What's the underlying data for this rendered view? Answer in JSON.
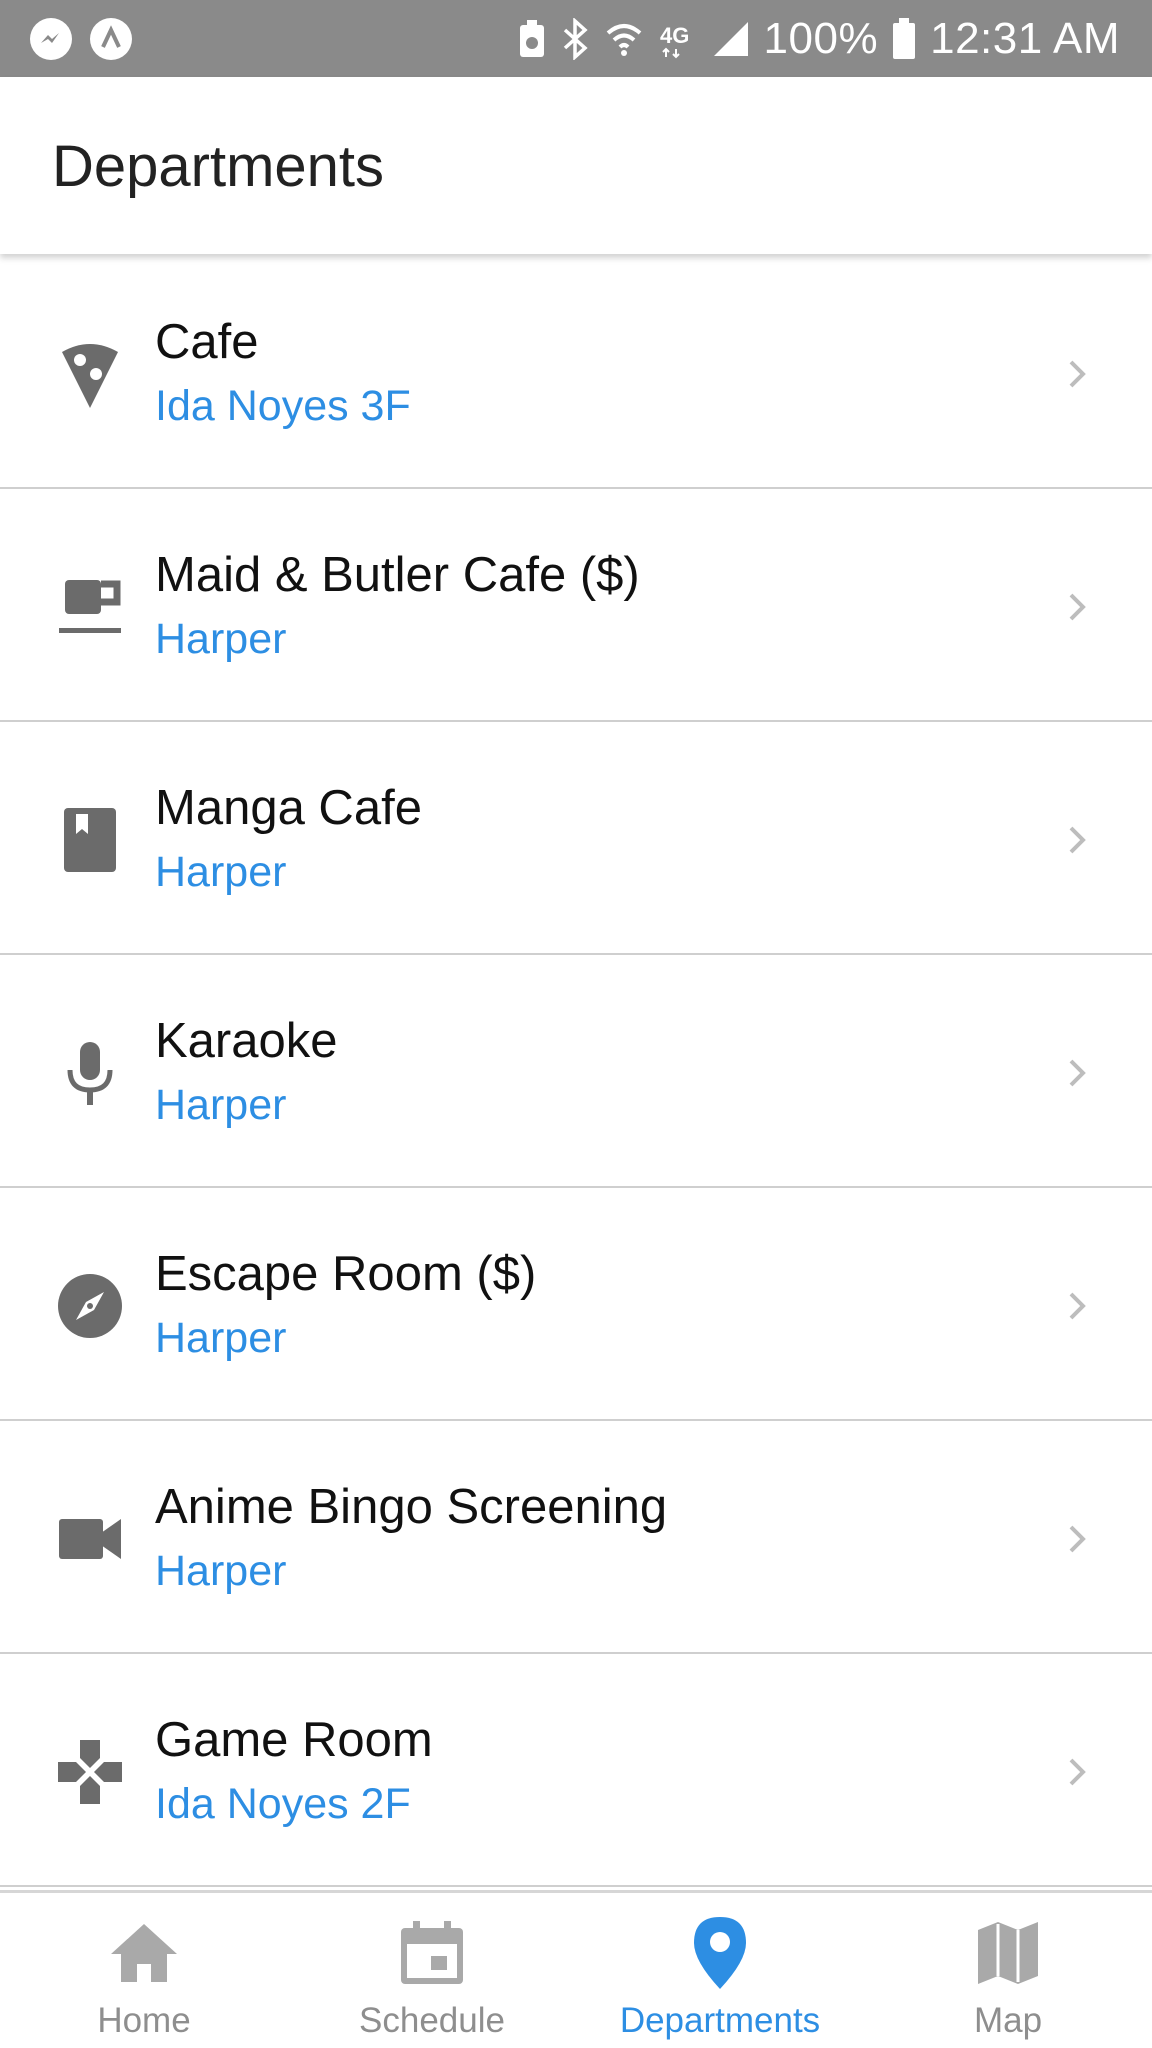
{
  "status_bar": {
    "battery": "100%",
    "time": "12:31 AM"
  },
  "header": {
    "title": "Departments"
  },
  "departments": [
    {
      "title": "Cafe",
      "location": "Ida Noyes 3F",
      "icon": "pizza-icon"
    },
    {
      "title": "Maid & Butler Cafe ($)",
      "location": "Harper",
      "icon": "coffee-cup-icon"
    },
    {
      "title": "Manga Cafe",
      "location": "Harper",
      "icon": "book-icon"
    },
    {
      "title": "Karaoke",
      "location": "Harper",
      "icon": "microphone-icon"
    },
    {
      "title": "Escape Room ($)",
      "location": "Harper",
      "icon": "compass-icon"
    },
    {
      "title": "Anime Bingo Screening",
      "location": "Harper",
      "icon": "video-camera-icon"
    },
    {
      "title": "Game Room",
      "location": "Ida Noyes 2F",
      "icon": "gamepad-icon"
    }
  ],
  "bottom_nav": {
    "tabs": [
      {
        "label": "Home",
        "icon": "home-icon",
        "active": false
      },
      {
        "label": "Schedule",
        "icon": "calendar-icon",
        "active": false
      },
      {
        "label": "Departments",
        "icon": "location-pin-icon",
        "active": true
      },
      {
        "label": "Map",
        "icon": "map-icon",
        "active": false
      }
    ]
  },
  "colors": {
    "accent": "#2d8ee3",
    "icon_gray": "#6b6b6b",
    "status_bar": "#8a8a8a",
    "divider": "#cfcfcf"
  }
}
